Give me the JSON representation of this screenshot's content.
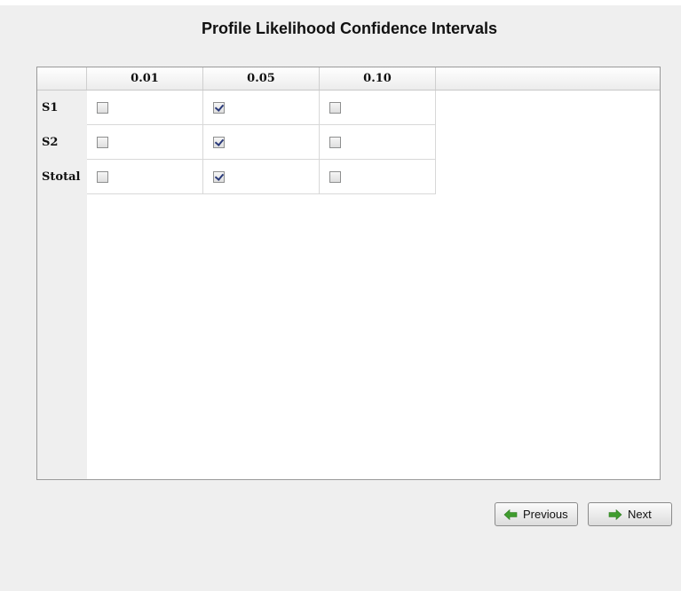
{
  "title": "Profile Likelihood Confidence Intervals",
  "table": {
    "columns": [
      "0.01",
      "0.05",
      "0.10"
    ],
    "rows": [
      {
        "label": "S1",
        "checked": [
          false,
          true,
          false
        ]
      },
      {
        "label": "S2",
        "checked": [
          false,
          true,
          false
        ]
      },
      {
        "label": "Stotal",
        "checked": [
          false,
          true,
          false
        ]
      }
    ]
  },
  "buttons": {
    "previous_label": "Previous",
    "next_label": "Next"
  },
  "colors": {
    "arrow_green": "#3f9c2e",
    "check_mark": "#2a3a7a"
  },
  "icons": {
    "previous": "arrow-left-icon",
    "next": "arrow-right-icon"
  }
}
